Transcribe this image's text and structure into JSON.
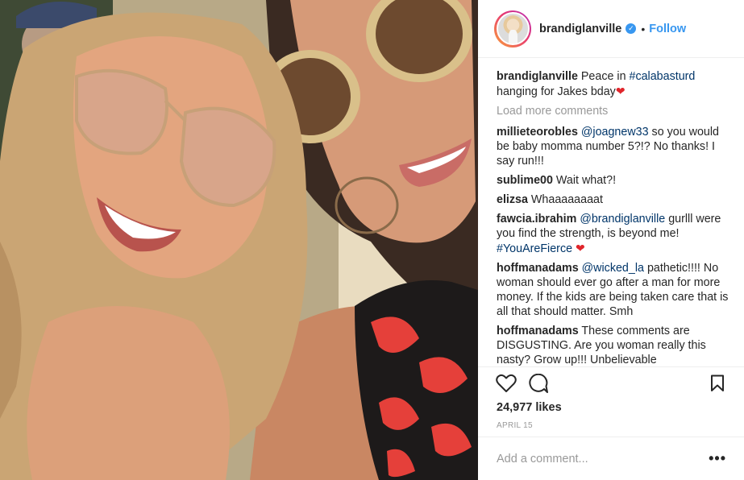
{
  "post": {
    "username": "brandiglanville",
    "follow_label": "Follow",
    "dot": "•",
    "verified_mark": "✓"
  },
  "caption": {
    "user": "brandiglanville",
    "text_before": " Peace in ",
    "hashtag": "#calabasturd",
    "text_after": " hanging for Jakes bday",
    "emoji": "❤"
  },
  "load_more_label": "Load more comments",
  "comments": [
    {
      "user": "millieteorobles",
      "mention": "@joagnew33",
      "text": " so you would be baby momma number 5?!? No thanks! I say run!!!"
    },
    {
      "user": "sublime00",
      "text": " Wait what?!"
    },
    {
      "user": "elizsa",
      "text": " Whaaaaaaaat"
    },
    {
      "user": "fawcia.ibrahim",
      "mention": "@brandiglanville",
      "text": " gurlll were you find the strength, is beyond me! ",
      "hashtag": "#YouAreFierce",
      "emoji": "❤"
    },
    {
      "user": "hoffmanadams",
      "mention": "@wicked_la",
      "text": " pathetic!!!! No woman should ever go after a man for more money. If the kids are being taken care that is all that should matter. Smh"
    },
    {
      "user": "hoffmanadams",
      "text": " These comments are DISGUSTING. Are you woman really this nasty? Grow up!!! Unbelievable"
    }
  ],
  "icons": {
    "like": "heart-outline-icon",
    "comment": "comment-bubble-icon",
    "save": "bookmark-icon",
    "more": "more-options-icon"
  },
  "likes": "24,977 likes",
  "date": "APRIL 15",
  "add_comment_placeholder": "Add a comment...",
  "more_label": "•••",
  "colors": {
    "accent": "#3897f0",
    "mention": "#003569",
    "heart": "#e0252b",
    "muted": "#999999"
  }
}
